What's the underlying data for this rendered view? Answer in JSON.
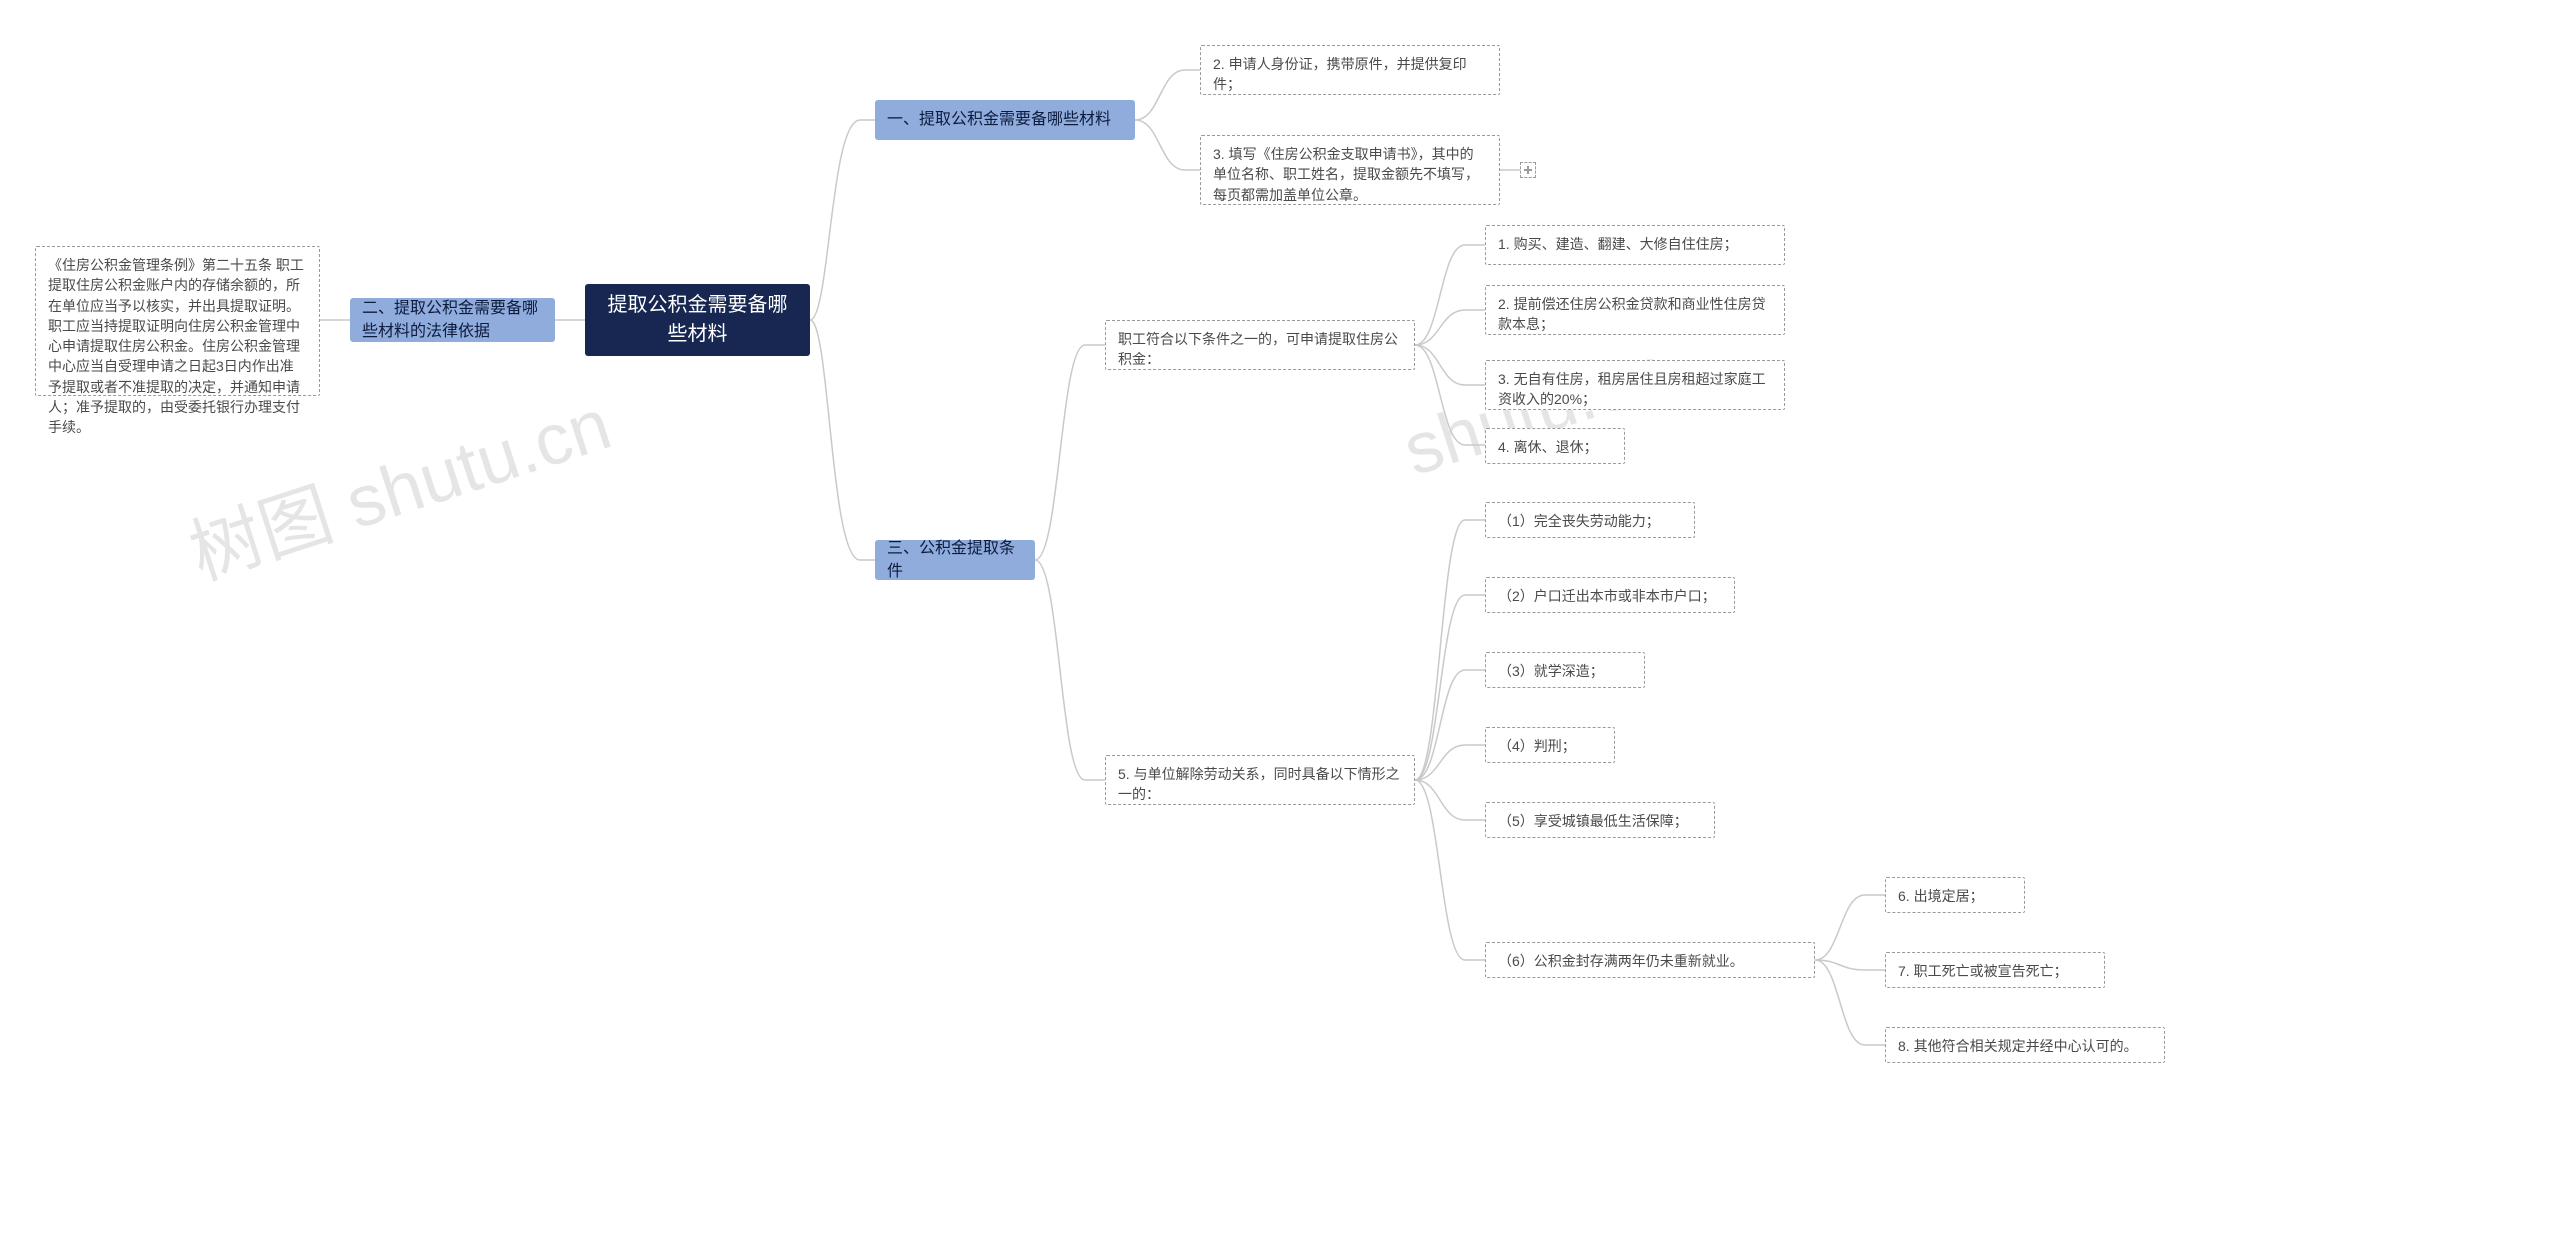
{
  "watermark": {
    "text1": "树图 shutu.cn",
    "text2": "shutu.cn"
  },
  "root": {
    "title": "提取公积金需要备哪些材料"
  },
  "branch_left": {
    "title": "二、提取公积金需要备哪些材料的法律依据",
    "detail": "《住房公积金管理条例》第二十五条 职工提取住房公积金账户内的存储余额的，所在单位应当予以核实，并出具提取证明。职工应当持提取证明向住房公积金管理中心申请提取住房公积金。住房公积金管理中心应当自受理申请之日起3日内作出准予提取或者不准提取的决定，并通知申请人；准予提取的，由受委托银行办理支付手续。"
  },
  "branch_r1": {
    "title": "一、提取公积金需要备哪些材料",
    "children": {
      "c1": "2. 申请人身份证，携带原件，并提供复印件；",
      "c2": "3. 填写《住房公积金支取申请书》，其中的单位名称、职工姓名，提取金额先不填写，每页都需加盖单位公章。"
    }
  },
  "branch_r3": {
    "title": "三、公积金提取条件",
    "groupA": {
      "header": "职工符合以下条件之一的，可申请提取住房公积金：",
      "items": {
        "i1": "1. 购买、建造、翻建、大修自住住房；",
        "i2": "2. 提前偿还住房公积金贷款和商业性住房贷款本息；",
        "i3": "3. 无自有住房，租房居住且房租超过家庭工资收入的20%；",
        "i4": "4. 离休、退休；"
      }
    },
    "groupB": {
      "header": "5. 与单位解除劳动关系，同时具备以下情形之一的：",
      "items": {
        "j1": "（1）完全丧失劳动能力；",
        "j2": "（2）户口迁出本市或非本市户口；",
        "j3": "（3）就学深造；",
        "j4": "（4）判刑；",
        "j5": "（5）享受城镇最低生活保障；",
        "j6": "（6）公积金封存满两年仍未重新就业。"
      },
      "extra": {
        "e6": "6. 出境定居；",
        "e7": "7. 职工死亡或被宣告死亡；",
        "e8": "8. 其他符合相关规定并经中心认可的。"
      }
    }
  }
}
